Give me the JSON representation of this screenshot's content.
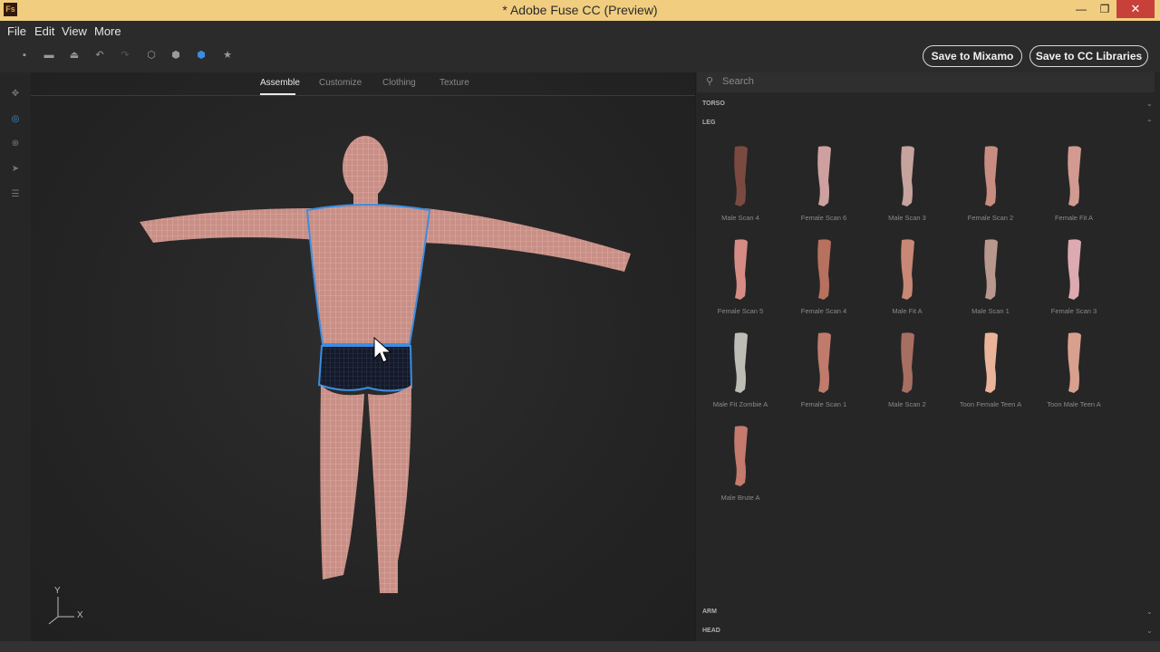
{
  "window": {
    "title": "* Adobe Fuse CC (Preview)",
    "app_badge": "Fs",
    "minimize": "—",
    "maximize": "❐",
    "close": "✕"
  },
  "menu": [
    "File",
    "Edit",
    "View",
    "More"
  ],
  "toolbar": {
    "tools": [
      {
        "name": "new-icon",
        "glyph": "▪"
      },
      {
        "name": "open-icon",
        "glyph": "▬"
      },
      {
        "name": "export-icon",
        "glyph": "⏏"
      },
      {
        "name": "undo-icon",
        "glyph": "↶"
      },
      {
        "name": "redo-icon",
        "glyph": "↷"
      },
      {
        "name": "cube-wire-icon",
        "glyph": "⬡"
      },
      {
        "name": "cube-solid-icon",
        "glyph": "⬢"
      },
      {
        "name": "cube-active-icon",
        "glyph": "⬢"
      },
      {
        "name": "star-icon",
        "glyph": "★"
      }
    ],
    "save_mixamo": "Save to Mixamo",
    "save_cc": "Save to CC Libraries"
  },
  "tabs": [
    "Assemble",
    "Customize",
    "Clothing",
    "Texture"
  ],
  "active_tab": "Assemble",
  "search": {
    "placeholder": "Search",
    "icon": "⚲"
  },
  "sections": {
    "torso": "TORSO",
    "leg": "LEG",
    "arm": "ARM",
    "head": "HEAD"
  },
  "leg_items": [
    "Male Scan 4",
    "Female Scan 6",
    "Male Scan 3",
    "Female Scan 2",
    "Female Fit A",
    "Female Scan 5",
    "Female Scan 4",
    "Male Fit A",
    "Male Scan 1",
    "Female Scan 3",
    "Male Fit Zombie A",
    "Female Scan 1",
    "Male Scan 2",
    "Toon Female Teen A",
    "Toon Male Teen A",
    "Male Brute A"
  ],
  "axis": {
    "y": "Y",
    "x": "X"
  },
  "colors": {
    "accent": "#3b8de0",
    "titlebar": "#f1cd7f",
    "close": "#c7403a"
  }
}
